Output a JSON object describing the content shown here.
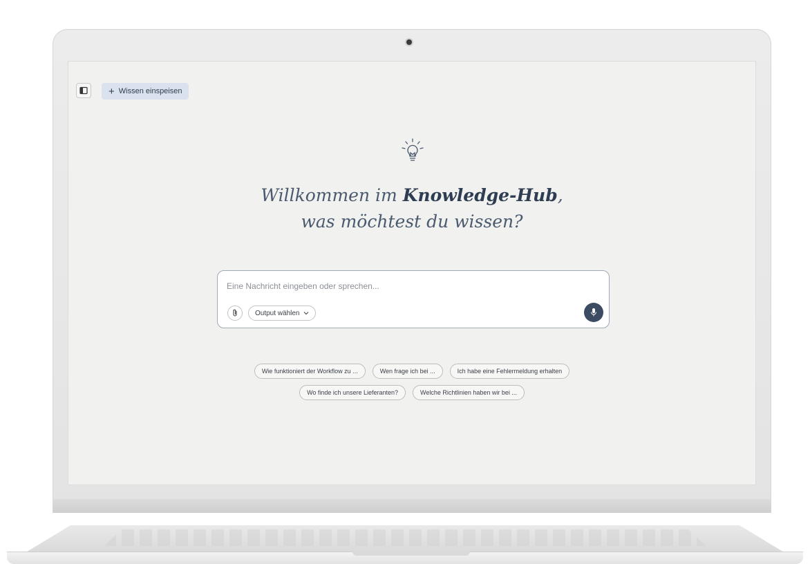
{
  "toolbar": {
    "sidebar_toggle_icon": "sidebar-panel-icon",
    "add_button_icon": "plus-icon",
    "add_button_label": "Wissen einspeisen"
  },
  "hero": {
    "icon": "lightbulb-icon",
    "title_line1_prefix": "Willkommen im ",
    "title_line1_bold": "Knowledge-Hub",
    "title_line1_suffix": ",",
    "title_line2": "was möchtest du wissen?"
  },
  "composer": {
    "placeholder": "Eine Nachricht eingeben oder sprechen...",
    "value": "",
    "attach_icon": "paperclip-icon",
    "output_select_label": "Output wählen",
    "output_select_icon": "chevron-down-icon",
    "mic_icon": "microphone-icon"
  },
  "suggestions": {
    "row1": [
      "Wie funktioniert der Workflow zu ...",
      "Wen frage ich bei ...",
      "Ich habe eine Fehlermeldung erhalten"
    ],
    "row2": [
      "Wo finde ich unsere Lieferanten?",
      "Welche Richtlinien haben wir bei ..."
    ]
  },
  "colors": {
    "accent": "#3b4b62",
    "add_button_bg": "#d9e2ee",
    "screen_bg": "#f1f1f0",
    "headline": "#4a5a6e"
  }
}
